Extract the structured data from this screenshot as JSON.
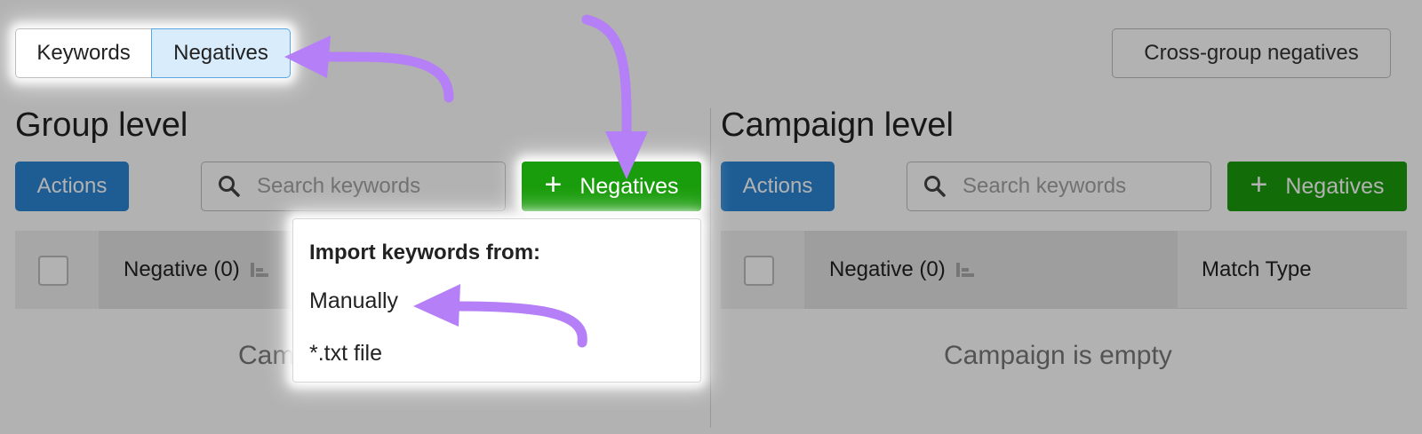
{
  "toggle": {
    "keywords_label": "Keywords",
    "negatives_label": "Negatives"
  },
  "cross_group_label": "Cross-group negatives",
  "group": {
    "title": "Group level",
    "actions_label": "Actions",
    "search_placeholder": "Search keywords",
    "negatives_button": "Negatives",
    "col_negative": "Negative (0)",
    "empty_text": "Cam"
  },
  "campaign": {
    "title": "Campaign level",
    "actions_label": "Actions",
    "search_placeholder": "Search keywords",
    "negatives_button": "Negatives",
    "col_negative": "Negative (0)",
    "col_match": "Match Type",
    "empty_text": "Campaign is empty"
  },
  "dropdown": {
    "title": "Import keywords from:",
    "items": [
      "Manually",
      "*.txt file"
    ]
  },
  "colors": {
    "accent_blue": "#2a86d4",
    "accent_green": "#1a9d0c",
    "arrow": "#b57ff7"
  }
}
